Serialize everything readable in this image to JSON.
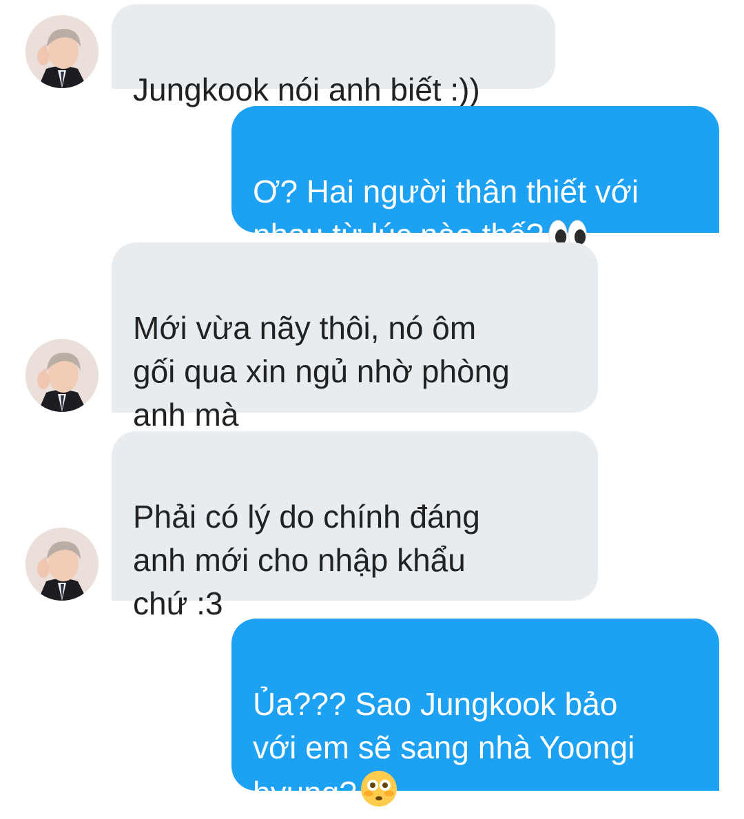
{
  "colors": {
    "incoming_bubble": "#e6ecf0",
    "outgoing_bubble": "#1da1f2",
    "incoming_text": "#222222",
    "outgoing_text": "#ffffff"
  },
  "messages": [
    {
      "direction": "incoming",
      "text": "Jungkook nói anh biết :))",
      "avatar": "person-avatar"
    },
    {
      "direction": "outgoing",
      "text": "Ơ? Hai người thân thiết với\nnhau từ lúc nào thế?",
      "emoji": "eyes-emoji"
    },
    {
      "direction": "incoming",
      "text": "Mới vừa nãy thôi, nó ôm\ngối qua xin ngủ nhờ phòng\nanh mà",
      "avatar": "person-avatar"
    },
    {
      "direction": "incoming",
      "text": "Phải có lý do chính đáng\nanh mới cho nhập khẩu\nchứ :3",
      "avatar": "person-avatar"
    },
    {
      "direction": "outgoing",
      "text": "Ủa??? Sao Jungkook bảo\nvới em sẽ sang nhà Yoongi\nhyung?",
      "emoji": "flushed-face-emoji"
    }
  ]
}
